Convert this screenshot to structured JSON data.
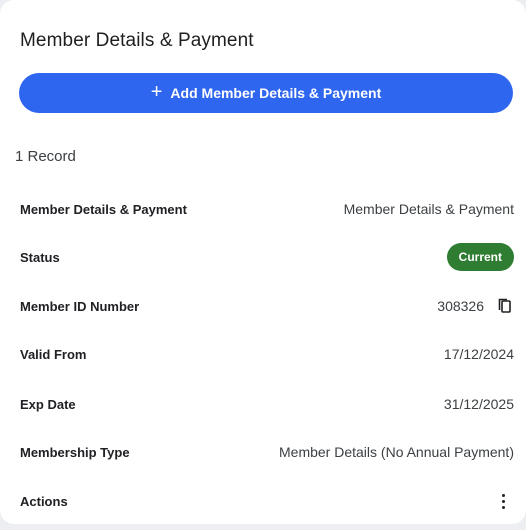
{
  "card": {
    "title": "Member Details & Payment",
    "add_button_label": "Add Member Details & Payment",
    "record_count": "1 Record"
  },
  "fields": [
    {
      "label": "Member Details & Payment",
      "value": "Member Details & Payment"
    },
    {
      "label": "Status",
      "value": "Current"
    },
    {
      "label": "Member ID Number",
      "value": "308326"
    },
    {
      "label": "Valid From",
      "value": "17/12/2024"
    },
    {
      "label": "Exp Date",
      "value": "31/12/2025"
    },
    {
      "label": "Membership Type",
      "value": "Member Details (No Annual Payment)"
    },
    {
      "label": "Actions",
      "value": ""
    }
  ],
  "icons": {
    "add": "plus-icon",
    "copy": "copy-icon",
    "actions": "more-vertical-icon"
  },
  "colors": {
    "primary_button": "#2f66f0",
    "status_current": "#2e7d32"
  }
}
